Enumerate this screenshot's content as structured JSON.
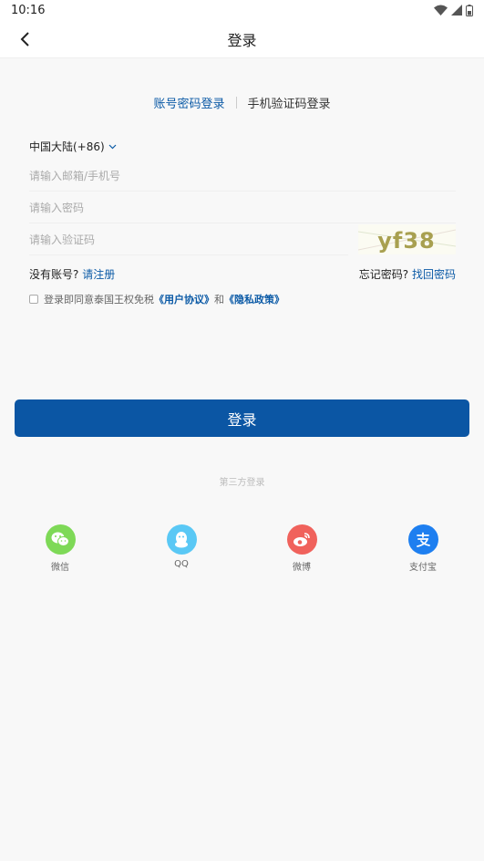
{
  "status_bar": {
    "time": "10:16"
  },
  "header": {
    "title": "登录"
  },
  "tabs": [
    {
      "label": "账号密码登录",
      "active": true
    },
    {
      "label": "手机验证码登录",
      "active": false
    }
  ],
  "region": {
    "label": "中国大陆(+86)"
  },
  "form": {
    "email_placeholder": "请输入邮箱/手机号",
    "password_placeholder": "请输入密码",
    "code_placeholder": "请输入验证码",
    "captcha_text": "yf38"
  },
  "links": {
    "no_account": "没有账号?",
    "register": "请注册",
    "forgot": "忘记密码?",
    "recover": "找回密码"
  },
  "agreement": {
    "prefix": "登录即同意泰国王权免税",
    "user_agreement": "《用户协议》",
    "and": "和",
    "privacy": "《隐私政策》"
  },
  "login_button": "登录",
  "third_party": {
    "label": "第三方登录",
    "items": [
      {
        "label": "微信",
        "icon": "wechat-icon",
        "color": "#7ed957"
      },
      {
        "label": "QQ",
        "icon": "qq-icon",
        "color": "#5ac8f5"
      },
      {
        "label": "微博",
        "icon": "weibo-icon",
        "color": "#f0625c"
      },
      {
        "label": "支付宝",
        "icon": "alipay-icon",
        "color": "#1e7ff0"
      }
    ]
  },
  "colors": {
    "accent": "#0b56a4",
    "link": "#0b5aa6"
  }
}
